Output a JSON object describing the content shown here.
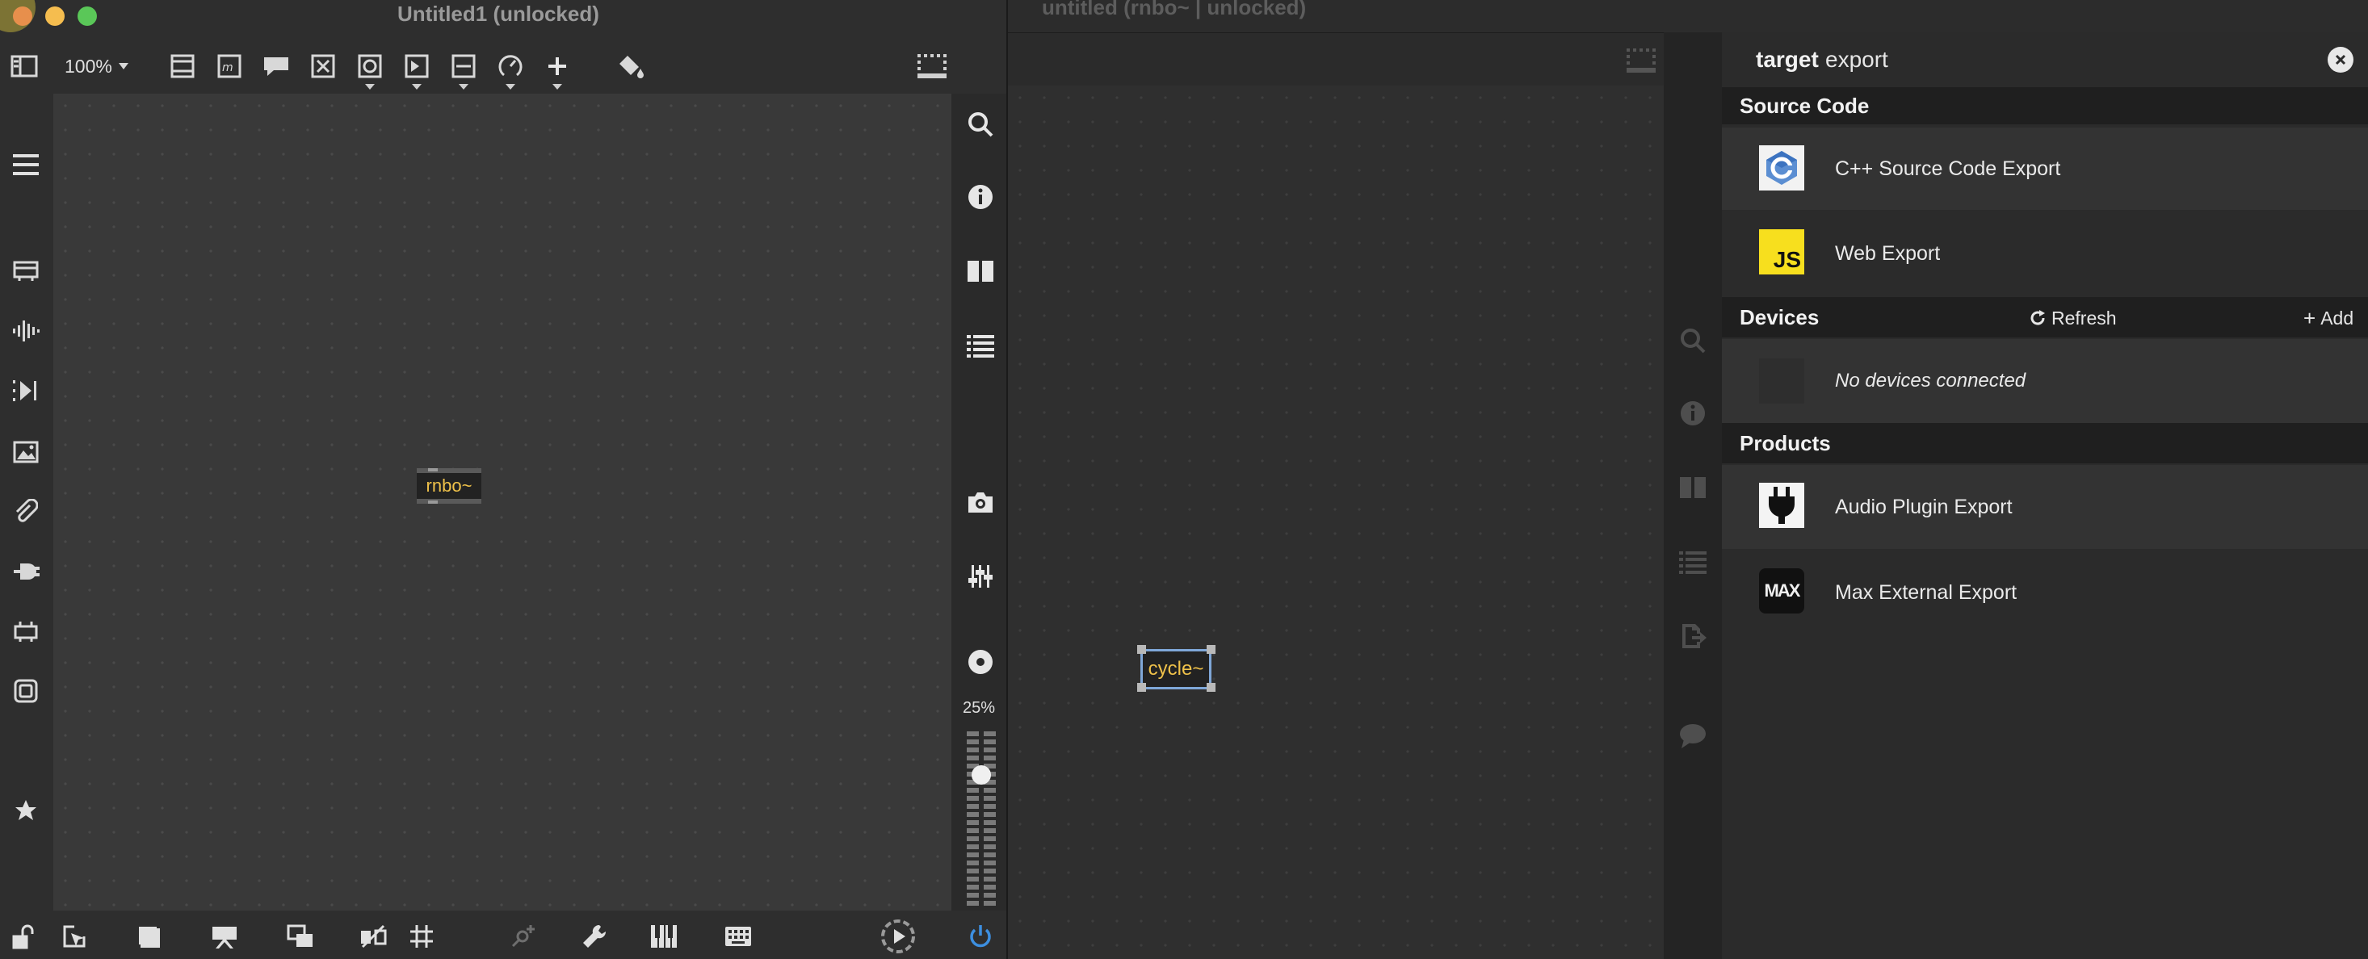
{
  "left_window": {
    "title": "Untitled1 (unlocked)",
    "zoom_label": "100%",
    "zoom_slider_label": "25%",
    "object_label": "rnbo~"
  },
  "right_window": {
    "title": "untitled (rnbo~ | unlocked)",
    "object_label": "cycle~"
  },
  "export_panel": {
    "heading_bold": "target",
    "heading_light": "export",
    "sections": {
      "source_code": "Source Code",
      "devices": "Devices",
      "products": "Products"
    },
    "items": {
      "cpp": "C++ Source Code Export",
      "web": "Web Export",
      "web_badge": "JS",
      "audio_plugin": "Audio Plugin Export",
      "max_external": "Max External Export",
      "max_badge": "MAX"
    },
    "refresh_label": "Refresh",
    "add_label": "Add",
    "no_devices": "No devices connected"
  },
  "colors": {
    "object_text": "#f0c24a",
    "power_button": "#3d8fe0",
    "js_badge": "#f7df1e",
    "selection_blue": "#7fa7d8"
  }
}
